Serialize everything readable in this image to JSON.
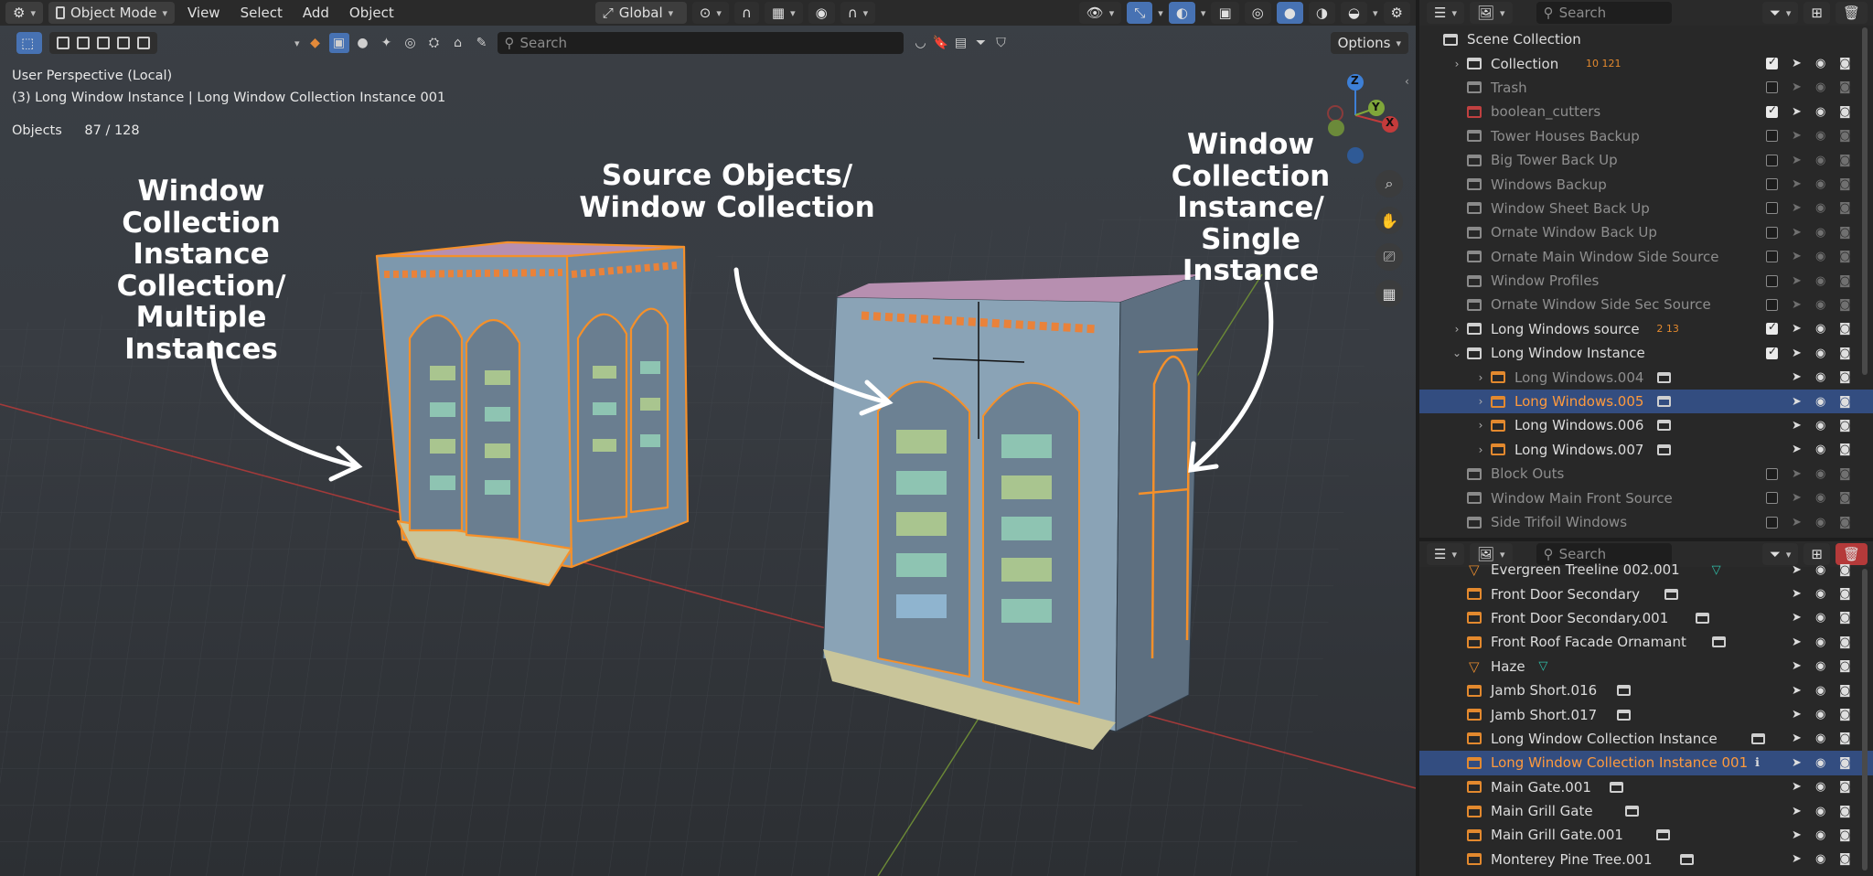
{
  "viewport": {
    "header": {
      "mode_label": "Object Mode",
      "menus": [
        "View",
        "Select",
        "Add",
        "Object"
      ],
      "transform_orientation": "Global"
    },
    "toolbar": {
      "search_placeholder": "Search",
      "options_label": "Options"
    },
    "info": {
      "perspective": "User Perspective (Local)",
      "context": "(3) Long Window Instance | Long Window Collection Instance 001",
      "objects_label": "Objects",
      "objects_count": "87 / 128"
    },
    "gizmo": {
      "x": "X",
      "y": "Y",
      "z": "Z"
    },
    "annotations": {
      "left": [
        "Window",
        "Collection",
        "Instance",
        "Collection/",
        "Multiple Instances"
      ],
      "middle": [
        "Source Objects/",
        "Window Collection"
      ],
      "right": [
        "Window",
        "Collection",
        "Instance/",
        "Single Instance"
      ]
    },
    "colors": {
      "selection_orange": "#f5902a",
      "building_blue": "#7d98ad",
      "roof_pink": "#b78fb0",
      "base_khaki": "#c9c59a",
      "x_axis_red": "#c33b3b",
      "y_axis_green": "#7fa63a"
    }
  },
  "outliner_top": {
    "search_placeholder": "Search",
    "rows": [
      {
        "label": "Scene Collection",
        "indent": 0,
        "expander": "",
        "icon": "collection",
        "checkbox": null,
        "extra": ""
      },
      {
        "label": "Collection",
        "indent": 1,
        "expander": "›",
        "icon": "collection",
        "checkbox": true,
        "extra": "10 121"
      },
      {
        "label": "Trash",
        "indent": 1,
        "expander": "",
        "icon": "collection-gray",
        "checkbox": false,
        "dim": true,
        "extra": ""
      },
      {
        "label": "boolean_cutters",
        "indent": 1,
        "expander": "",
        "icon": "collection-red",
        "checkbox": true,
        "dim": true,
        "extra": ""
      },
      {
        "label": "Tower Houses Backup",
        "indent": 1,
        "expander": "",
        "icon": "collection-gray",
        "checkbox": false,
        "dim": true,
        "extra": ""
      },
      {
        "label": "Big Tower Back Up",
        "indent": 1,
        "expander": "",
        "icon": "collection-gray",
        "checkbox": false,
        "dim": true,
        "extra": ""
      },
      {
        "label": "Windows Backup",
        "indent": 1,
        "expander": "",
        "icon": "collection-gray",
        "checkbox": false,
        "dim": true,
        "extra": ""
      },
      {
        "label": "Window Sheet Back Up",
        "indent": 1,
        "expander": "",
        "icon": "collection-gray",
        "checkbox": false,
        "dim": true,
        "extra": ""
      },
      {
        "label": "Ornate Window Back Up",
        "indent": 1,
        "expander": "",
        "icon": "collection-gray",
        "checkbox": false,
        "dim": true,
        "extra": ""
      },
      {
        "label": "Ornate Main Window Side Source",
        "indent": 1,
        "expander": "",
        "icon": "collection-gray",
        "checkbox": false,
        "dim": true,
        "extra": ""
      },
      {
        "label": "Window Profiles",
        "indent": 1,
        "expander": "",
        "icon": "collection-gray",
        "checkbox": false,
        "dim": true,
        "extra": ""
      },
      {
        "label": "Ornate Window Side Sec Source",
        "indent": 1,
        "expander": "",
        "icon": "collection-gray",
        "checkbox": false,
        "dim": true,
        "extra": ""
      },
      {
        "label": "Long Windows source",
        "indent": 1,
        "expander": "›",
        "icon": "collection",
        "checkbox": true,
        "extra": "2 13"
      },
      {
        "label": "Long Window Instance",
        "indent": 1,
        "expander": "⌄",
        "icon": "collection",
        "checkbox": true,
        "extra": ""
      },
      {
        "label": "Long Windows.004",
        "indent": 2,
        "expander": "›",
        "icon": "instance",
        "checkbox": null,
        "dim": true,
        "extra": "box"
      },
      {
        "label": "Long Windows.005",
        "indent": 2,
        "expander": "›",
        "icon": "instance",
        "checkbox": null,
        "selected": true,
        "active": true,
        "extra": "box"
      },
      {
        "label": "Long Windows.006",
        "indent": 2,
        "expander": "›",
        "icon": "instance",
        "checkbox": null,
        "extra": "box"
      },
      {
        "label": "Long Windows.007",
        "indent": 2,
        "expander": "›",
        "icon": "instance",
        "checkbox": null,
        "extra": "box"
      },
      {
        "label": "Block Outs",
        "indent": 1,
        "expander": "",
        "icon": "collection-gray",
        "checkbox": false,
        "dim": true,
        "extra": ""
      },
      {
        "label": "Window Main Front Source",
        "indent": 1,
        "expander": "",
        "icon": "collection-gray",
        "checkbox": false,
        "dim": true,
        "extra": ""
      },
      {
        "label": "Side Trifoil Windows",
        "indent": 1,
        "expander": "",
        "icon": "collection-gray",
        "checkbox": false,
        "dim": true,
        "extra": ""
      }
    ]
  },
  "outliner_bottom": {
    "search_placeholder": "Search",
    "rows": [
      {
        "label": "Evergreen Treeline 002.001",
        "icon": "cone",
        "extra": "cone"
      },
      {
        "label": "Front Door Secondary",
        "icon": "instance",
        "extra": "box"
      },
      {
        "label": "Front Door Secondary.001",
        "icon": "instance",
        "extra": "box"
      },
      {
        "label": "Front Roof Facade Ornamant",
        "icon": "instance",
        "extra": "box"
      },
      {
        "label": "Haze",
        "icon": "cone",
        "extra": "cone"
      },
      {
        "label": "Jamb Short.016",
        "icon": "instance",
        "extra": "box"
      },
      {
        "label": "Jamb Short.017",
        "icon": "instance",
        "extra": "box"
      },
      {
        "label": "Long Window Collection Instance",
        "icon": "instance",
        "extra": "box"
      },
      {
        "label": "Long Window Collection Instance 001",
        "icon": "instance",
        "extra": "info",
        "selected": true,
        "active": true
      },
      {
        "label": "Main Gate.001",
        "icon": "instance",
        "extra": "box"
      },
      {
        "label": "Main Grill Gate",
        "icon": "instance",
        "extra": "box"
      },
      {
        "label": "Main Grill Gate.001",
        "icon": "instance",
        "extra": "box"
      },
      {
        "label": "Monterey Pine Tree.001",
        "icon": "instance",
        "extra": "box"
      }
    ]
  }
}
